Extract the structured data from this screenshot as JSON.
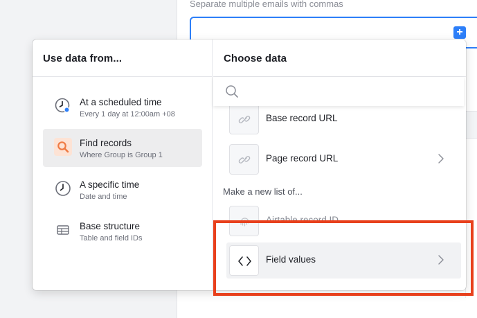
{
  "background": {
    "helper_text": "Separate multiple emails with commas",
    "add_button_label": "+",
    "accent_color": "#2d7ff9"
  },
  "popover": {
    "left_column": {
      "heading": "Use data from...",
      "items": [
        {
          "title": "At a scheduled time",
          "subtitle": "Every 1 day at 12:00am +08",
          "icon": "clock-icon",
          "selected": false
        },
        {
          "title": "Find records",
          "subtitle": "Where Group is Group 1",
          "icon": "search-icon",
          "selected": true
        },
        {
          "title": "A specific time",
          "subtitle": "Date and time",
          "icon": "clock-icon",
          "selected": false
        },
        {
          "title": "Base structure",
          "subtitle": "Table and field IDs",
          "icon": "table-icon",
          "selected": false
        }
      ]
    },
    "right_column": {
      "heading": "Choose data",
      "search": {
        "placeholder": "",
        "value": ""
      },
      "options": [
        {
          "label": "Base record URL",
          "icon": "link-icon",
          "has_chevron": false
        },
        {
          "label": "Page record URL",
          "icon": "link-icon",
          "has_chevron": true
        }
      ],
      "section_label": "Make a new list of...",
      "list_options": [
        {
          "label": "Airtable record ID",
          "icon": "fingerprint-icon",
          "has_chevron": false
        },
        {
          "label": "Field values",
          "icon": "code-brackets-icon",
          "has_chevron": true
        }
      ]
    }
  },
  "annotation": {
    "color": "#e8401c"
  },
  "colors": {
    "selected_bg": "#ededee",
    "search_icon_accent": "#ef7a43",
    "badge_blue": "#2d7ff9"
  }
}
